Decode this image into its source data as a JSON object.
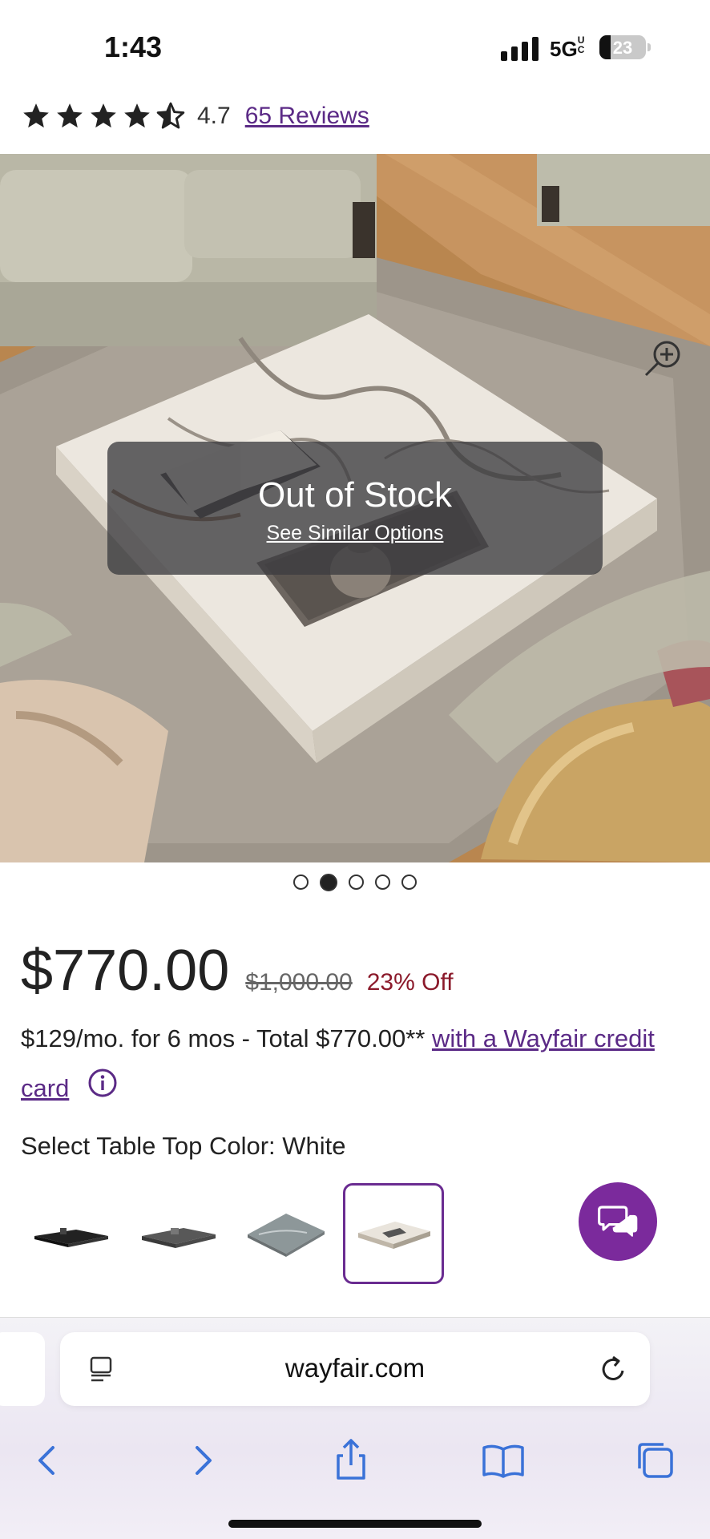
{
  "status_bar": {
    "time": "1:43",
    "network": "5G",
    "network_suffix": "UC",
    "battery": "23"
  },
  "rating": {
    "value": "4.7",
    "stars": 4.5,
    "reviews_link": "65 Reviews"
  },
  "product_image": {
    "overlay_title": "Out of Stock",
    "overlay_link": "See Similar Options",
    "icons": {
      "zoom": "zoom-in-icon"
    }
  },
  "pagination": {
    "total": 5,
    "active_index": 1
  },
  "price": {
    "current": "$770.00",
    "original": "$1,000.00",
    "discount": "23% Off"
  },
  "financing": {
    "text": "$129/mo. for 6 mos - Total $770.00** ",
    "link": "with a Wayfair credit card"
  },
  "options": {
    "label": "Select Table Top Color: White",
    "selected_index": 3,
    "accent": "#6a2c91"
  },
  "chat": {
    "icon": "chat-bubbles-icon",
    "color": "#7b2a9c"
  },
  "browser": {
    "url": "wayfair.com",
    "icons": [
      "back-icon",
      "forward-icon",
      "share-icon",
      "bookmarks-icon",
      "tabs-icon"
    ]
  }
}
